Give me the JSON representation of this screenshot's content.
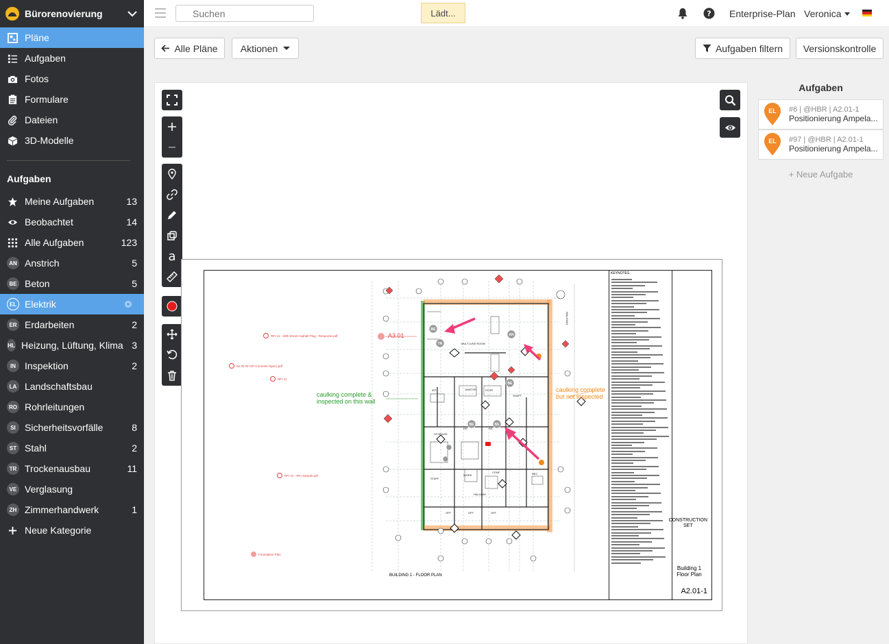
{
  "project": {
    "name": "Bürorenovierung"
  },
  "nav": [
    {
      "label": "Pläne",
      "icon": "plans-icon",
      "active": true
    },
    {
      "label": "Aufgaben",
      "icon": "tasks-icon"
    },
    {
      "label": "Fotos",
      "icon": "camera-icon"
    },
    {
      "label": "Formulare",
      "icon": "forms-icon"
    },
    {
      "label": "Dateien",
      "icon": "paperclip-icon"
    },
    {
      "label": "3D-Modelle",
      "icon": "cube-icon"
    }
  ],
  "tasks_section": {
    "heading": "Aufgaben",
    "filters": [
      {
        "label": "Meine Aufgaben",
        "icon": "star-icon",
        "count": "13"
      },
      {
        "label": "Beobachtet",
        "icon": "eye-icon",
        "count": "14"
      },
      {
        "label": "Alle Aufgaben",
        "icon": "grid-icon",
        "count": "123"
      }
    ],
    "categories": [
      {
        "code": "AN",
        "label": "Anstrich",
        "count": "5"
      },
      {
        "code": "BE",
        "label": "Beton",
        "count": "5"
      },
      {
        "code": "EL",
        "label": "Elektrik",
        "count": "",
        "active": true
      },
      {
        "code": "ER",
        "label": "Erdarbeiten",
        "count": "2"
      },
      {
        "code": "HL",
        "label": "Heizung, Lüftung, Klima",
        "count": "3"
      },
      {
        "code": "IN",
        "label": "Inspektion",
        "count": "2"
      },
      {
        "code": "LA",
        "label": "Landschaftsbau",
        "count": ""
      },
      {
        "code": "RO",
        "label": "Rohrleitungen",
        "count": ""
      },
      {
        "code": "SI",
        "label": "Sicherheitsvorfälle",
        "count": "8"
      },
      {
        "code": "ST",
        "label": "Stahl",
        "count": "2"
      },
      {
        "code": "TR",
        "label": "Trockenausbau",
        "count": "11"
      },
      {
        "code": "VE",
        "label": "Verglasung",
        "count": ""
      },
      {
        "code": "ZH",
        "label": "Zimmerhandwerk",
        "count": "1"
      }
    ],
    "new_category": "Neue Kategorie"
  },
  "topbar": {
    "search_placeholder": "Suchen",
    "loading": "Lädt...",
    "plan_link": "Enterprise-Plan",
    "user": "Veronica"
  },
  "toolbar": {
    "all_plans": "Alle Pläne",
    "actions": "Aktionen",
    "filter_tasks": "Aufgaben filtern",
    "version_control": "Versionskontrolle"
  },
  "drawing": {
    "keynotes_title": "KEYNOTES",
    "plan_caption": "BUILDING 1 - FLOOR PLAN",
    "sheet_set": "CONSTRUCTION SET",
    "sheet_title": "Building 1 Floor Plan",
    "sheet_number": "A2.01-1",
    "annotation_green": "caulking complete & inspected on this wall",
    "annotation_orange": "caulking complete but not inspected",
    "annotation_red": "A3.01",
    "links": [
      "RFI 21 - 28th Street Asphalt Plug - Response.pdf",
      "03 30 00 CIP Concrete Specs.pdf",
      "RFI 41",
      "RFI 41 - RFI Sample.pdf",
      "Foundation Plan"
    ]
  },
  "task_panel": {
    "title": "Aufgaben",
    "tasks": [
      {
        "badge": "EL",
        "meta": "#6 | @HBR | A2.01-1",
        "title": "Positionierung Ampela..."
      },
      {
        "badge": "EL",
        "meta": "#97 | @HBR | A2.01-1",
        "title": "Positionierung Ampela..."
      }
    ],
    "new_task": "+ Neue Aufgabe"
  },
  "colors": {
    "sidebar_bg": "#2f3033",
    "active": "#5aa3e8",
    "pin": "#f08a2a",
    "annotation_green": "#2a9a2a",
    "annotation_orange": "#f08a1a",
    "annotation_red": "#e84040"
  }
}
